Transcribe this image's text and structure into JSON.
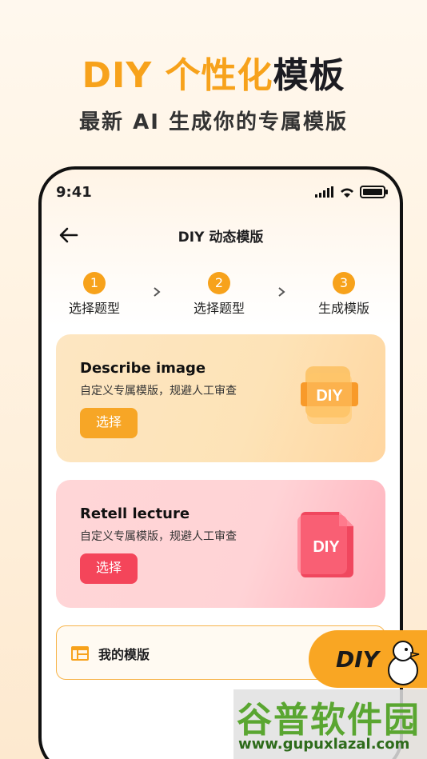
{
  "headline": {
    "accent": "DIY 个性化",
    "dark": "模板"
  },
  "subhead": "最新 AI 生成你的专属模版",
  "status": {
    "time": "9:41"
  },
  "nav": {
    "title": "DIY 动态模版"
  },
  "steps": [
    {
      "num": "1",
      "label": "选择题型"
    },
    {
      "num": "2",
      "label": "选择题型"
    },
    {
      "num": "3",
      "label": "生成模版"
    }
  ],
  "cards": [
    {
      "title": "Describe image",
      "desc": "自定义专属模版，规避人工审查",
      "button": "选择",
      "art_text": "DIY",
      "color": "#f7a626"
    },
    {
      "title": "Retell lecture",
      "desc": "自定义专属模版，规避人工审查",
      "button": "选择",
      "art_text": "DIY",
      "color": "#f4455a"
    }
  ],
  "mine": {
    "label": "我的模版"
  },
  "float_button": {
    "label": "DIY"
  },
  "watermark": {
    "name": "谷普软件园",
    "url": "www.gupuxlazal.com"
  },
  "colors": {
    "accent": "#f7a21b",
    "pink": "#f4455a"
  }
}
